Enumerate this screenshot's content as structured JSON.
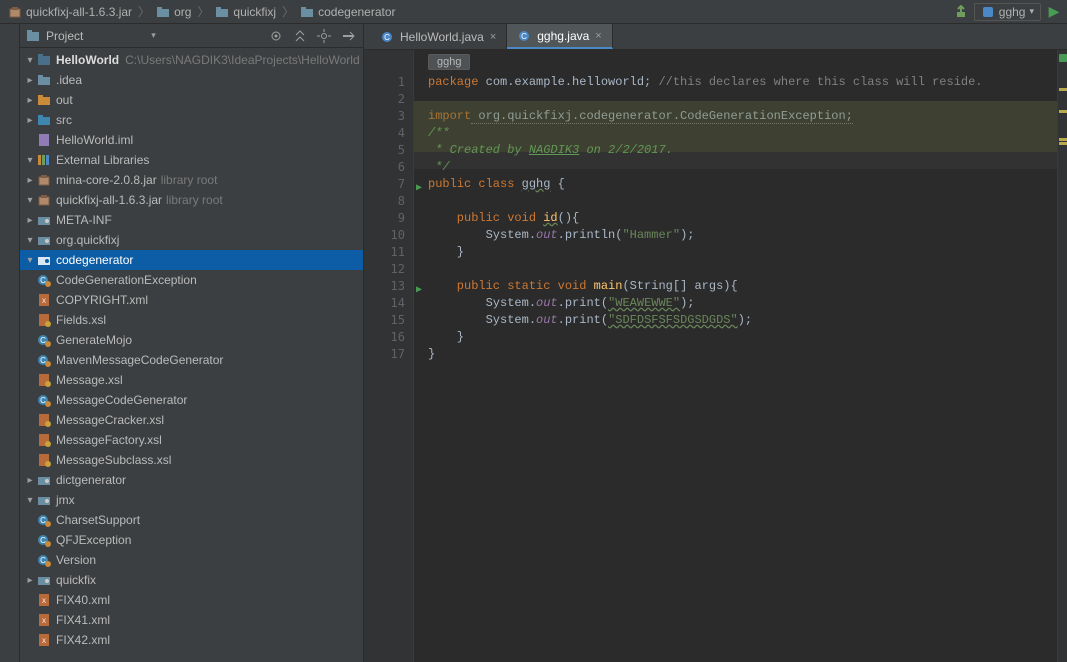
{
  "breadcrumb": {
    "items": [
      {
        "label": "quickfixj-all-1.6.3.jar",
        "icon": "jar"
      },
      {
        "label": "org",
        "icon": "folder"
      },
      {
        "label": "quickfixj",
        "icon": "folder"
      },
      {
        "label": "codegenerator",
        "icon": "folder"
      }
    ]
  },
  "run_config": {
    "label": "gghg"
  },
  "project_panel": {
    "title": "Project",
    "root": {
      "name": "HelloWorld",
      "path": "C:\\Users\\NAGDIK3\\IdeaProjects\\HelloWorld"
    },
    "root_children": [
      {
        "name": ".idea",
        "type": "folder"
      },
      {
        "name": "out",
        "type": "folder-orange"
      },
      {
        "name": "src",
        "type": "folder-blue"
      },
      {
        "name": "HelloWorld.iml",
        "type": "iml"
      }
    ],
    "external_lib_label": "External Libraries",
    "libs": [
      {
        "name": "mina-core-2.0.8.jar",
        "suffix": "library root",
        "expanded": false
      },
      {
        "name": "quickfixj-all-1.6.3.jar",
        "suffix": "library root",
        "expanded": true
      }
    ],
    "qfj_children": [
      {
        "name": "META-INF",
        "type": "pkg",
        "expanded": false
      },
      {
        "name": "org.quickfixj",
        "type": "pkg",
        "expanded": true
      }
    ],
    "org_quickfixj_children": [
      {
        "name": "codegenerator",
        "type": "pkg",
        "expanded": true,
        "selected": true
      },
      {
        "name": "dictgenerator",
        "type": "pkg",
        "expanded": false
      },
      {
        "name": "jmx",
        "type": "pkg",
        "expanded": true
      },
      {
        "name": "quickfix",
        "type": "pkg",
        "expanded": false
      }
    ],
    "codegenerator_files": [
      {
        "name": "CodeGenerationException",
        "icon": "class-annotated"
      },
      {
        "name": "COPYRIGHT.xml",
        "icon": "xml"
      },
      {
        "name": "Fields.xsl",
        "icon": "xsl"
      },
      {
        "name": "GenerateMojo",
        "icon": "class-annotated"
      },
      {
        "name": "MavenMessageCodeGenerator",
        "icon": "class-annotated"
      },
      {
        "name": "Message.xsl",
        "icon": "xsl"
      },
      {
        "name": "MessageCodeGenerator",
        "icon": "class-annotated"
      },
      {
        "name": "MessageCracker.xsl",
        "icon": "xsl"
      },
      {
        "name": "MessageFactory.xsl",
        "icon": "xsl"
      },
      {
        "name": "MessageSubclass.xsl",
        "icon": "xsl"
      }
    ],
    "jmx_files": [
      {
        "name": "CharsetSupport",
        "icon": "class-annotated"
      },
      {
        "name": "QFJException",
        "icon": "class-annotated"
      },
      {
        "name": "Version",
        "icon": "class-annotated"
      }
    ],
    "fix_files": [
      {
        "name": "FIX40.xml",
        "icon": "xml"
      },
      {
        "name": "FIX41.xml",
        "icon": "xml"
      },
      {
        "name": "FIX42.xml",
        "icon": "xml"
      }
    ]
  },
  "tabs": [
    {
      "label": "HelloWorld.java",
      "active": false
    },
    {
      "label": "gghg.java",
      "active": true
    }
  ],
  "editor": {
    "chip": "gghg",
    "line_count": 17,
    "code_tokens": {
      "pkg_kw": "package",
      "pkg_val": " com.example.helloworld;",
      "pkg_cmt": " //this declares where this class will reside.",
      "imp_kw": "import",
      "imp_val": " org.quickfixj.codegenerator.CodeGenerationException;",
      "doc1": "/**",
      "doc2": " * Created by ",
      "doc2u": "NAGDIK3",
      "doc2b": " on 2/2/2017.",
      "doc3": " */",
      "cls1a": "public class ",
      "cls1b": "gghg",
      "cls1c": " {",
      "m1a": "    public void ",
      "m1b": "id",
      "m1c": "(){",
      "p1a": "        System.",
      "p1b": "out",
      "p1c": ".println(",
      "p1s": "\"Hammer\"",
      "p1d": ");",
      "close1": "    }",
      "m2a": "    public static void ",
      "m2b": "main",
      "m2c": "(String[] args){",
      "p2a": "        System.",
      "p2b": "out",
      "p2c": ".print(",
      "p2s": "\"WEAWEWWE\"",
      "p2d": ");",
      "p3a": "        System.",
      "p3b": "out",
      "p3c": ".print(",
      "p3s": "\"SDFDSFSFSDGSDGDS\"",
      "p3d": ");",
      "close2": "    }",
      "close3": "}"
    }
  },
  "icons": {
    "chevron_right": "▸",
    "chevron_down": "▾",
    "play": "▶",
    "close": "×",
    "sep": "〉"
  }
}
